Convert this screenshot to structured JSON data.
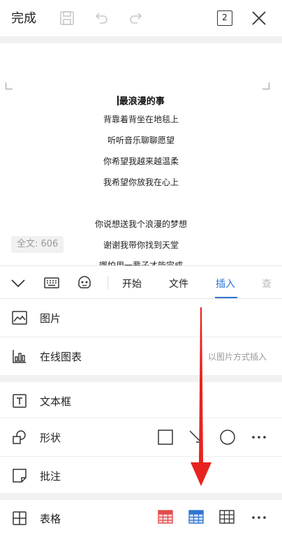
{
  "toolbar": {
    "done_label": "完成",
    "tab_count": "2"
  },
  "document": {
    "title": "最浪漫的事",
    "lines": [
      "背靠着背坐在地毯上",
      "听听音乐聊聊愿望",
      "你希望我越来越温柔",
      "我希望你放我在心上",
      "",
      "你说想送我个浪漫的梦想",
      "谢谢我带你找到天堂",
      "哪怕用一辈子才能完成"
    ],
    "word_count": "全文: 606"
  },
  "tabs": {
    "items": [
      "开始",
      "文件",
      "插入",
      "查"
    ],
    "active": "插入"
  },
  "menu": {
    "picture": "图片",
    "online_chart": "在线图表",
    "online_chart_hint": "以图片方式插入",
    "textbox": "文本框",
    "shape": "形状",
    "comment": "批注",
    "table": "表格"
  },
  "colors": {
    "accent": "#2f74d0",
    "annotation_arrow": "#e8231f",
    "table_red": "#e34b4b",
    "table_blue": "#2f74d0"
  }
}
